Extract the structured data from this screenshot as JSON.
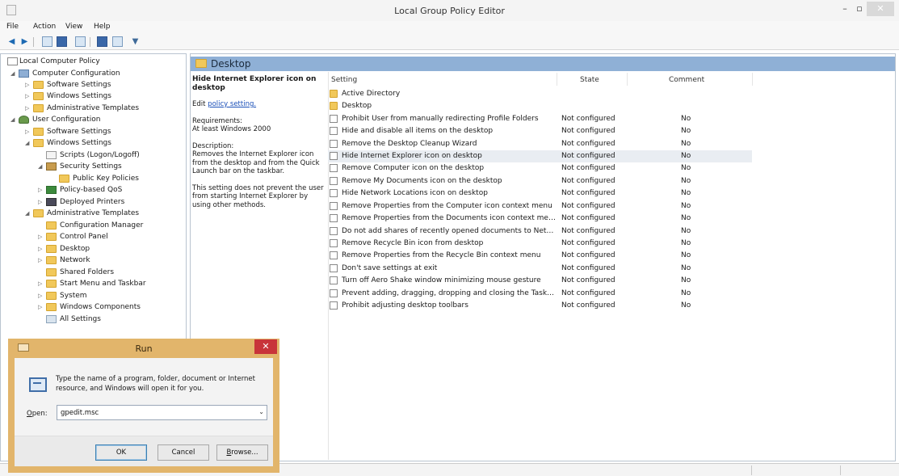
{
  "window": {
    "title": "Local Group Policy Editor",
    "min": "–",
    "max": "▫",
    "close": "✕"
  },
  "menu": {
    "file": "File",
    "action": "Action",
    "view": "View",
    "help": "Help"
  },
  "tree": {
    "root": "Local Computer Policy",
    "computer_configuration": "Computer Configuration",
    "cc_software_settings": "Software Settings",
    "cc_windows_settings": "Windows Settings",
    "cc_administrative_templates": "Administrative Templates",
    "user_configuration": "User Configuration",
    "uc_software_settings": "Software Settings",
    "uc_windows_settings": "Windows Settings",
    "scripts": "Scripts (Logon/Logoff)",
    "security_settings": "Security Settings",
    "public_key_policies": "Public Key Policies",
    "policy_based_qos": "Policy-based QoS",
    "deployed_printers": "Deployed Printers",
    "uc_administrative_templates": "Administrative Templates",
    "configuration_manager": "Configuration Manager",
    "control_panel": "Control Panel",
    "desktop": "Desktop",
    "network": "Network",
    "shared_folders": "Shared Folders",
    "start_menu": "Start Menu and Taskbar",
    "system": "System",
    "windows_components": "Windows Components",
    "all_settings": "All Settings"
  },
  "pane": {
    "header": "Desktop",
    "policy_title": "Hide Internet Explorer icon on desktop",
    "edit_prefix": "Edit ",
    "edit_link": "policy setting.",
    "requirements_label": "Requirements:",
    "requirements_value": "At least Windows 2000",
    "description_label": "Description:",
    "description_1": "Removes the Internet Explorer icon from the desktop and from the Quick Launch bar on the taskbar.",
    "description_2": "This setting does not prevent the user from starting Internet Explorer by using other methods."
  },
  "columns": {
    "setting": "Setting",
    "state": "State",
    "comment": "Comment"
  },
  "folders": [
    "Active Directory",
    "Desktop"
  ],
  "settings": [
    {
      "name": "Prohibit User from manually redirecting Profile Folders",
      "state": "Not configured",
      "comment": "No"
    },
    {
      "name": "Hide and disable all items on the desktop",
      "state": "Not configured",
      "comment": "No"
    },
    {
      "name": "Remove the Desktop Cleanup Wizard",
      "state": "Not configured",
      "comment": "No"
    },
    {
      "name": "Hide Internet Explorer icon on desktop",
      "state": "Not configured",
      "comment": "No"
    },
    {
      "name": "Remove Computer icon on the desktop",
      "state": "Not configured",
      "comment": "No"
    },
    {
      "name": "Remove My Documents icon on the desktop",
      "state": "Not configured",
      "comment": "No"
    },
    {
      "name": "Hide Network Locations icon on desktop",
      "state": "Not configured",
      "comment": "No"
    },
    {
      "name": "Remove Properties from the Computer icon context menu",
      "state": "Not configured",
      "comment": "No"
    },
    {
      "name": "Remove Properties from the Documents icon context menu",
      "state": "Not configured",
      "comment": "No"
    },
    {
      "name": "Do not add shares of recently opened documents to Networ...",
      "state": "Not configured",
      "comment": "No"
    },
    {
      "name": "Remove Recycle Bin icon from desktop",
      "state": "Not configured",
      "comment": "No"
    },
    {
      "name": "Remove Properties from the Recycle Bin context menu",
      "state": "Not configured",
      "comment": "No"
    },
    {
      "name": "Don't save settings at exit",
      "state": "Not configured",
      "comment": "No"
    },
    {
      "name": "Turn off Aero Shake window minimizing mouse gesture",
      "state": "Not configured",
      "comment": "No"
    },
    {
      "name": "Prevent adding, dragging, dropping and closing the Taskbar...",
      "state": "Not configured",
      "comment": "No"
    },
    {
      "name": "Prohibit adjusting desktop toolbars",
      "state": "Not configured",
      "comment": "No"
    }
  ],
  "run_dialog": {
    "title": "Run",
    "close": "✕",
    "prompt": "Type the name of a program, folder, document or Internet resource, and Windows will open it for you.",
    "open_label_u": "O",
    "open_label_rest": "pen:",
    "input_value": "gpedit.msc",
    "dropdown": "⌄",
    "ok": "OK",
    "cancel": "Cancel",
    "browse_u": "B",
    "browse_rest": "rowse..."
  }
}
